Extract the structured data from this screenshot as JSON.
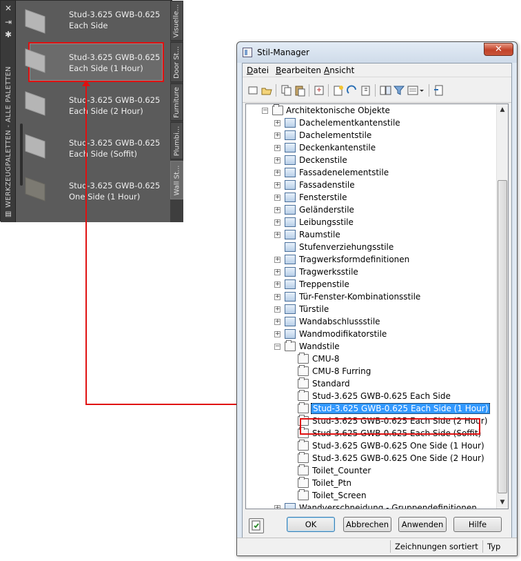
{
  "palette": {
    "side_title": "WERKZEUGPALETTEN - ALLE PALETTEN",
    "items": [
      {
        "line1": "Stud-3.625 GWB-0.625",
        "line2": "Each Side"
      },
      {
        "line1": "Stud-3.625 GWB-0.625",
        "line2": "Each Side (1 Hour)"
      },
      {
        "line1": "Stud-3.625 GWB-0.625",
        "line2": "Each Side (2 Hour)"
      },
      {
        "line1": "Stud-3.625 GWB-0.625",
        "line2": "Each Side (Soffit)"
      },
      {
        "line1": "Stud-3.625 GWB-0.625",
        "line2": "One Side (1 Hour)"
      }
    ],
    "tabs": [
      "Visuelle...",
      "Door St...",
      "Furniture",
      "Plumbi...",
      "Wall St..."
    ]
  },
  "dialog": {
    "title": "Stil-Manager",
    "close_glyph": "✕",
    "menu": [
      {
        "pre": "",
        "u": "D",
        "post": "atei"
      },
      {
        "pre": "",
        "u": "B",
        "post": "earbeiten"
      },
      {
        "pre": "",
        "u": "A",
        "post": "nsicht"
      }
    ],
    "tree": {
      "root": "Architektonische Objekte",
      "categories": [
        "Dachelementkantenstile",
        "Dachelementstile",
        "Deckenkantenstile",
        "Deckenstile",
        "Fassadenelementstile",
        "Fassadenstile",
        "Fensterstile",
        "Geländerstile",
        "Leibungsstile",
        "Raumstile",
        "Stufenverziehungsstile",
        "Tragwerksformdefinitionen",
        "Tragwerksstile",
        "Treppenstile",
        "Tür-Fenster-Kombinationsstile",
        "Türstile",
        "Wandabschlussstile",
        "Wandmodifikatorstile"
      ],
      "expanded": "Wandstile",
      "children": [
        "CMU-8",
        "CMU-8 Furring",
        "Standard",
        "Stud-3.625 GWB-0.625 Each Side",
        "Stud-3.625 GWB-0.625 Each Side (1 Hour)",
        "Stud-3.625 GWB-0.625 Each Side (2 Hour)",
        "Stud-3.625 GWB-0.625 Each Side (Soffit)",
        "Stud-3.625 GWB-0.625 One Side (1 Hour)",
        "Stud-3.625 GWB-0.625 One Side (2 Hour)",
        "Toilet_Counter",
        "Toilet_Ptn",
        "Toilet_Screen"
      ],
      "last": "Wandverschneidung - Gruppendefinitionen"
    },
    "buttons": {
      "ok": "OK",
      "cancel": "Abbrechen",
      "apply": "Anwenden",
      "help": "Hilfe"
    },
    "status": {
      "sorted": "Zeichnungen sortiert",
      "type": "Typ"
    }
  },
  "colors": {
    "highlight": "#e01010",
    "selection": "#3399ff"
  }
}
